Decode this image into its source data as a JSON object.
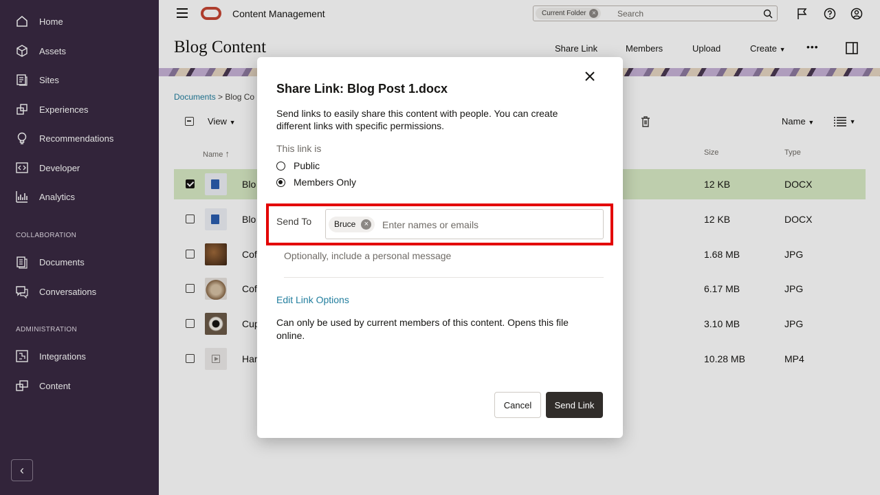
{
  "sidebar": {
    "items": [
      {
        "label": "Home",
        "icon": "home-icon"
      },
      {
        "label": "Assets",
        "icon": "cube-icon"
      },
      {
        "label": "Sites",
        "icon": "sites-icon"
      },
      {
        "label": "Experiences",
        "icon": "experiences-icon"
      },
      {
        "label": "Recommendations",
        "icon": "lightbulb-icon"
      },
      {
        "label": "Developer",
        "icon": "code-icon"
      },
      {
        "label": "Analytics",
        "icon": "chart-icon"
      }
    ],
    "collaboration_heading": "COLLABORATION",
    "collaboration_items": [
      {
        "label": "Documents",
        "icon": "document-icon"
      },
      {
        "label": "Conversations",
        "icon": "chat-icon"
      }
    ],
    "administration_heading": "ADMINISTRATION",
    "administration_items": [
      {
        "label": "Integrations",
        "icon": "integrations-icon"
      },
      {
        "label": "Content",
        "icon": "content-icon"
      }
    ],
    "collapse_symbol": "‹"
  },
  "topbar": {
    "app_title": "Content Management",
    "search_scope": "Current Folder",
    "search_placeholder": "Search"
  },
  "page": {
    "title": "Blog Content",
    "actions": [
      "Share Link",
      "Members",
      "Upload",
      "Create"
    ],
    "more_symbol": "•••",
    "breadcrumb_root": "Documents",
    "breadcrumb_sep": ">",
    "breadcrumb_current": "Blog Co",
    "view_label": "View",
    "sort_label": "Name"
  },
  "table": {
    "headers": {
      "name": "Name",
      "size": "Size",
      "type": "Type"
    },
    "rows": [
      {
        "name": "Blo",
        "size": "12 KB",
        "type": "DOCX",
        "selected": true
      },
      {
        "name": "Blo",
        "size": "12 KB",
        "type": "DOCX",
        "selected": false
      },
      {
        "name": "Cof",
        "size": "1.68 MB",
        "type": "JPG",
        "selected": false
      },
      {
        "name": "Cof",
        "size": "6.17 MB",
        "type": "JPG",
        "selected": false
      },
      {
        "name": "Cup",
        "size": "3.10 MB",
        "type": "JPG",
        "selected": false
      },
      {
        "name": "Har",
        "size": "10.28 MB",
        "type": "MP4",
        "selected": false
      }
    ]
  },
  "dialog": {
    "title": "Share Link: Blog Post 1.docx",
    "description": "Send links to easily share this content with people. You can create different links with specific permissions.",
    "link_is_label": "This link is",
    "option_public": "Public",
    "option_members": "Members Only",
    "selected_option": "Members Only",
    "send_to_label": "Send To",
    "recipient": "Bruce",
    "recipient_input_placeholder": "Enter names or emails",
    "message_placeholder": "Optionally, include a personal message",
    "edit_link_options": "Edit Link Options",
    "link_note": "Can only be used by current members of this content. Opens this file online.",
    "cancel_label": "Cancel",
    "send_label": "Send Link"
  },
  "colors": {
    "sidebar_bg": "#3a2a42",
    "selected_row": "#d9ebc5",
    "highlight": "#e30000",
    "primary_button": "#312d2a",
    "link": "#227e9e",
    "oracle_red": "#c74634"
  }
}
